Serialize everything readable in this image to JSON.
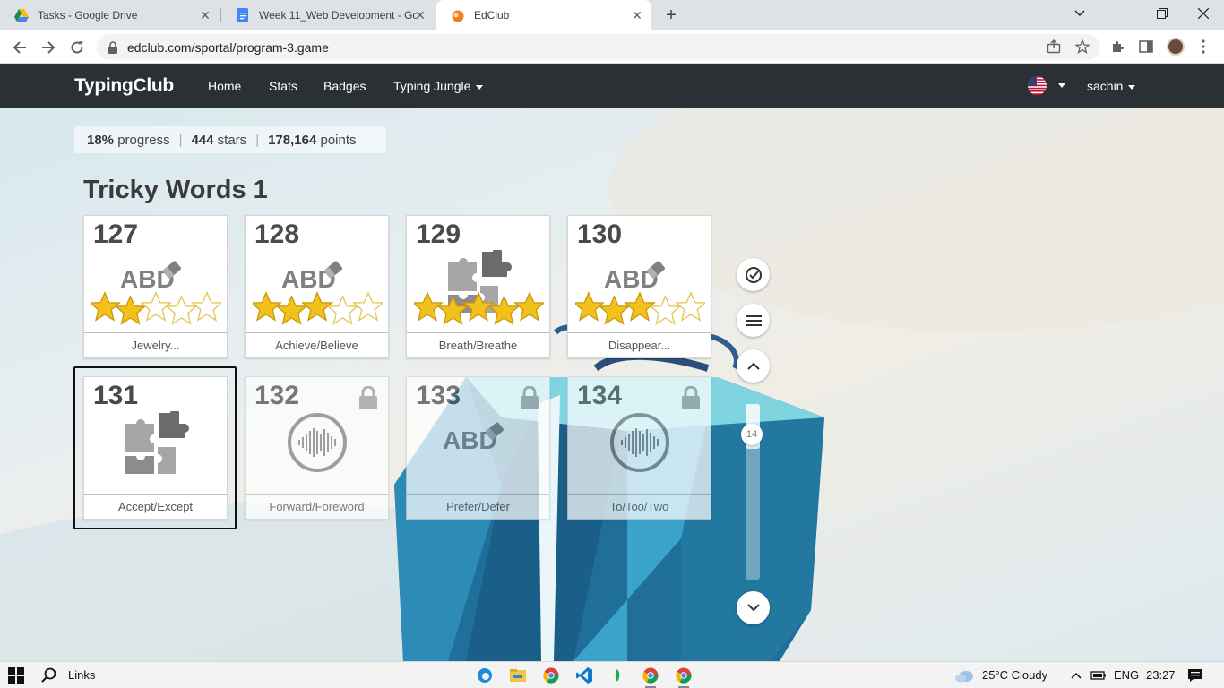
{
  "browser": {
    "tabs": [
      {
        "title": "Tasks - Google Drive",
        "active": false
      },
      {
        "title": "Week 11_Web Development - Go",
        "active": false
      },
      {
        "title": "EdClub",
        "active": true
      }
    ],
    "url": "edclub.com/sportal/program-3.game"
  },
  "site": {
    "brand": "TypingClub",
    "nav": [
      "Home",
      "Stats",
      "Badges",
      "Typing Jungle"
    ],
    "user": "sachin"
  },
  "stats": {
    "progress_value": "18%",
    "progress_label": "progress",
    "stars_value": "444",
    "stars_label": "stars",
    "points_value": "178,164",
    "points_label": "points"
  },
  "section": {
    "title": "Tricky Words 1"
  },
  "lessons": [
    {
      "number": "127",
      "name": "Jewelry...",
      "type": "keyboard",
      "stars": 2,
      "locked": false
    },
    {
      "number": "128",
      "name": "Achieve/Believe",
      "type": "keyboard",
      "stars": 3,
      "locked": false
    },
    {
      "number": "129",
      "name": "Breath/Breathe",
      "type": "puzzle",
      "stars": 5,
      "locked": false
    },
    {
      "number": "130",
      "name": "Disappear...",
      "type": "keyboard",
      "stars": 3,
      "locked": false
    },
    {
      "number": "131",
      "name": "Accept/Except",
      "type": "puzzle",
      "stars": 0,
      "locked": false,
      "selected": true
    },
    {
      "number": "132",
      "name": "Forward/Foreword",
      "type": "audio",
      "stars": 0,
      "locked": true
    },
    {
      "number": "133",
      "name": "Prefer/Defer",
      "type": "keyboard",
      "stars": 0,
      "locked": true
    },
    {
      "number": "134",
      "name": "To/Too/Two",
      "type": "audio",
      "stars": 0,
      "locked": true
    }
  ],
  "scroll": {
    "badge": "14"
  },
  "taskbar": {
    "search_label": "Links",
    "weather": "25°C  Cloudy",
    "lang": "ENG",
    "time": "23:27"
  },
  "colors": {
    "site_header": "#2b3035",
    "star_fill": "#f2c21b",
    "icon_gray": "#808080"
  }
}
